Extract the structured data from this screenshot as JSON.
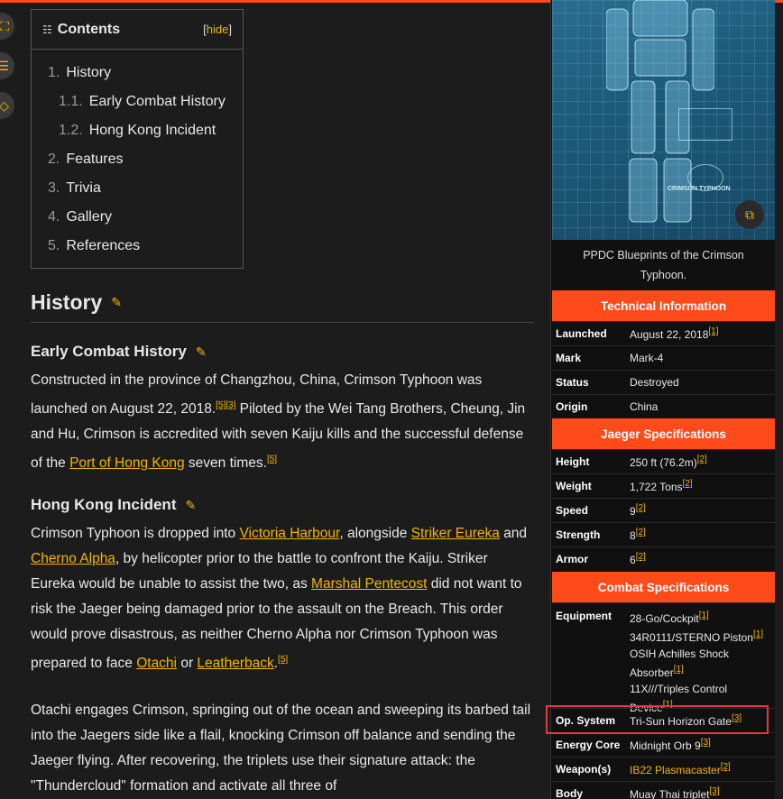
{
  "toc": {
    "title": "Contents",
    "hide_open": "[",
    "hide_label": "hide",
    "hide_close": "]",
    "items": [
      {
        "num": "1.",
        "label": "History"
      },
      {
        "num": "1.1.",
        "label": "Early Combat History"
      },
      {
        "num": "1.2.",
        "label": "Hong Kong Incident"
      },
      {
        "num": "2.",
        "label": "Features"
      },
      {
        "num": "3.",
        "label": "Trivia"
      },
      {
        "num": "4.",
        "label": "Gallery"
      },
      {
        "num": "5.",
        "label": "References"
      }
    ]
  },
  "article": {
    "history_heading": "History",
    "early_heading": "Early Combat History",
    "early_p1": "Constructed in the province of Changzhou, China, Crimson Typhoon was launched on August 22, 2018.",
    "early_ref1": "[5]",
    "early_ref2": "[3]",
    "early_p2": " Piloted by the Wei Tang Brothers, Cheung, Jin and Hu, Crimson is accredited with seven Kaiju kills and the successful defense of the ",
    "early_link": "Port of Hong Kong",
    "early_p3": " seven times.",
    "early_ref3": "[5]",
    "hk_heading": "Hong Kong Incident",
    "hk_p1a": "Crimson Typhoon is dropped into ",
    "hk_link1": "Victoria Harbour",
    "hk_p1b": ", alongside ",
    "hk_link2": "Striker Eureka",
    "hk_p1c": " and ",
    "hk_link3": "Cherno Alpha",
    "hk_p1d": ", by helicopter prior to the battle to confront the Kaiju. Striker Eureka would be unable to assist the two, as ",
    "hk_link4": "Marshal Pentecost",
    "hk_p1e": " did not want to risk the Jaeger being damaged prior to the assault on the Breach. This order would prove disastrous, as neither Cherno Alpha nor Crimson Typhoon was prepared to face ",
    "hk_link5": "Otachi",
    "hk_p1f": " or ",
    "hk_link6": "Leatherback",
    "hk_p1g": ".",
    "hk_ref": "[5]",
    "hk_p2": "Otachi engages Crimson, springing out of the ocean and sweeping its barbed tail into the Jaegers side like a flail, knocking Crimson off balance and sending the Jaeger flying. After recovering, the triplets use their signature attack: the \"Thundercloud\" formation and activate all three of"
  },
  "infobox": {
    "caption": "PPDC Blueprints of the Crimson Typhoon.",
    "blueprint_title": "CRIMSON TYPHOON",
    "technical_heading": "Technical Information",
    "jaeger_heading": "Jaeger Specifications",
    "combat_heading": "Combat Specifications",
    "rows": {
      "launched": {
        "k": "Launched",
        "v": "August 22, 2018",
        "ref": "[1]"
      },
      "mark": {
        "k": "Mark",
        "v": "Mark-4"
      },
      "status": {
        "k": "Status",
        "v": "Destroyed"
      },
      "origin": {
        "k": "Origin",
        "v": "China"
      },
      "height": {
        "k": "Height",
        "v": "250 ft (76.2m)",
        "ref": "[2]"
      },
      "weight": {
        "k": "Weight",
        "v": "1,722 Tons",
        "ref": "[2]"
      },
      "speed": {
        "k": "Speed",
        "v": "9",
        "ref": "[2]"
      },
      "strength": {
        "k": "Strength",
        "v": "8",
        "ref": "[2]"
      },
      "armor": {
        "k": "Armor",
        "v": "6",
        "ref": "[2]"
      },
      "equipment": {
        "k": "Equipment",
        "v1": "28-Go/Cockpit",
        "r1": "[1]",
        "v2": "34R0111/STERNO Piston",
        "r2": "[1]",
        "v3": "OSIH Achilles Shock Absorber",
        "r3": "[1]",
        "v4": "11X///Triples Control Device",
        "r4": "[1]"
      },
      "opsystem": {
        "k": "Op. System",
        "v": "Tri-Sun Horizon Gate",
        "ref": "[3]"
      },
      "energy": {
        "k": "Energy Core",
        "v": "Midnight Orb 9",
        "ref": "[3]"
      },
      "weapons": {
        "k": "Weapon(s)",
        "v": "IB22 Plasmacaster",
        "ref": "[2]"
      },
      "body": {
        "k": "Body",
        "v": "Muay Thai triplet",
        "ref": "[3]"
      }
    }
  },
  "colors": {
    "accent": "#ff4a1a",
    "link": "#f2b600",
    "background": "#1c1c1c",
    "highlight_box": "#e03b3b"
  },
  "icons": [
    "expand-icon",
    "list-icon",
    "tag-icon",
    "pencil-icon",
    "gallery-expand-icon"
  ]
}
